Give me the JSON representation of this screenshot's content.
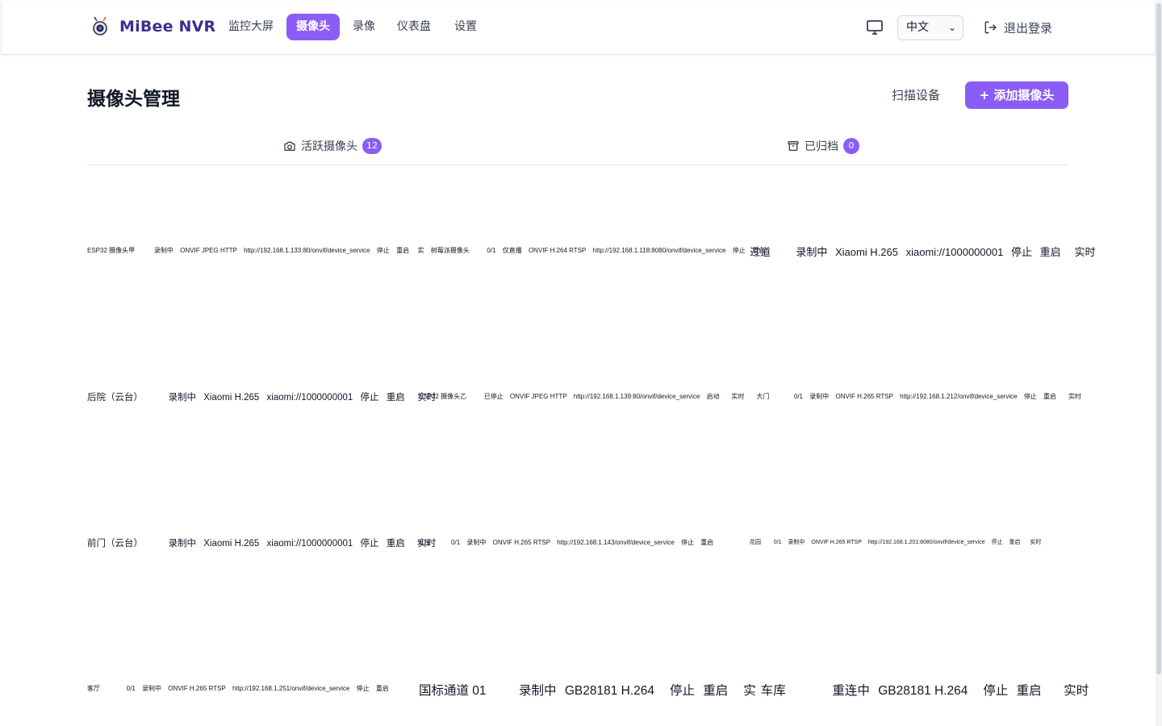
{
  "app": {
    "brand": "MiBee NVR"
  },
  "nav": {
    "items": [
      {
        "label": "监控大屏"
      },
      {
        "label": "摄像头"
      },
      {
        "label": "录像"
      },
      {
        "label": "仪表盘"
      },
      {
        "label": "设置"
      }
    ],
    "active": "摄像头"
  },
  "header": {
    "language": "中文",
    "logout_label": "退出登录"
  },
  "page": {
    "title": "摄像头管理",
    "scan_button": "扫描设备",
    "add_button": "+ 添加摄像头"
  },
  "tabs": {
    "active": {
      "label": "活跃摄像头",
      "count": "12"
    },
    "archived": {
      "label": "已归档",
      "count": "0"
    }
  },
  "cameras": [
    {
      "name": "ESP32 摄像头甲",
      "status": "录制中",
      "protocol": "ONVIF JPEG HTTP",
      "url": "http://192.168.1.133:80/onvif/device_service",
      "action1": "停止",
      "action2": "重启",
      "view": "实"
    },
    {
      "name": "树莓派摄像头",
      "ratio": "0/1",
      "status": "仅直播",
      "protocol": "ONVIF H.264 RTSP",
      "url": "http://192.168.1.118:8080/onvif/device_service",
      "action1": "停止",
      "action2": "重启"
    },
    {
      "name": "过道",
      "status": "录制中",
      "protocol": "Xiaomi H.265",
      "url": "xiaomi://1000000001",
      "action1": "停止",
      "action2": "重启",
      "view": "实时"
    },
    {
      "name": "后院（云台）",
      "status": "录制中",
      "protocol": "Xiaomi H.265",
      "url": "xiaomi://1000000001",
      "action1": "停止",
      "action2": "重启",
      "view": "实时"
    },
    {
      "name": "ESP32 摄像头乙",
      "status": "已停止",
      "protocol": "ONVIF JPEG HTTP",
      "url": "http://192.168.1.139:80/onvif/device_service",
      "action1": "启动",
      "view": "实时"
    },
    {
      "name": "大门",
      "ratio": "0/1",
      "status": "录制中",
      "protocol": "ONVIF H.265 RTSP",
      "url": "http://192.168.1.212/onvif/device_service",
      "action1": "停止",
      "action2": "重启",
      "view": "实时"
    },
    {
      "name": "前门（云台）",
      "status": "录制中",
      "protocol": "Xiaomi H.265",
      "url": "xiaomi://1000000001",
      "action1": "停止",
      "action2": "重启",
      "view": "实时"
    },
    {
      "name": "天台",
      "ratio": "0/1",
      "status": "录制中",
      "protocol": "ONVIF H.265 RTSP",
      "url": "http://192.168.1.143/onvif/device_service",
      "action1": "停止",
      "action2": "重启"
    },
    {
      "name": "花园",
      "ratio": "0/1",
      "status": "录制中",
      "protocol": "ONVIF H.265 RTSP",
      "url": "http://192.168.1.201:8080/onvif/device_service",
      "action1": "停止",
      "action2": "重启",
      "view": "实时"
    },
    {
      "name": "客厅",
      "ratio": "0/1",
      "status": "录制中",
      "protocol": "ONVIF H.265 RTSP",
      "url": "http://192.168.1.251/onvif/device_service",
      "action1": "停止",
      "action2": "重启"
    },
    {
      "name": "国标通道 01",
      "status": "录制中",
      "protocol": "GB28181 H.264",
      "action1": "停止",
      "action2": "重启",
      "view": "实"
    },
    {
      "name": "车库",
      "status": "重连中",
      "protocol": "GB28181 H.264",
      "action1": "停止",
      "action2": "重启",
      "view": "实时"
    }
  ]
}
